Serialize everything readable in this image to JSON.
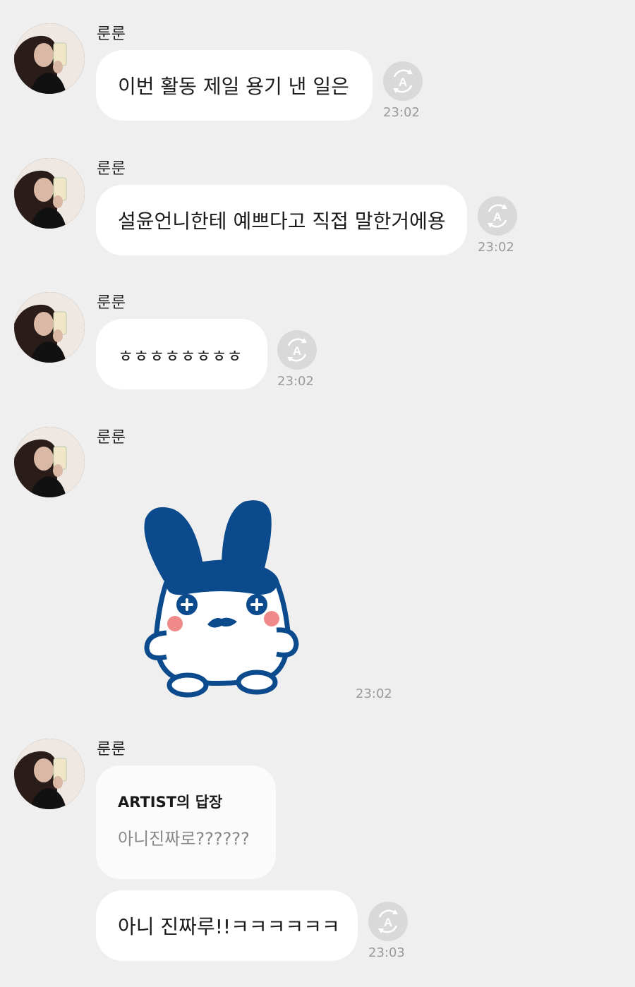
{
  "messages": [
    {
      "sender": "룬룬",
      "text": "이번 활동 제일 용기 낸 일은",
      "time": "23:02"
    },
    {
      "sender": "룬룬",
      "text": "설윤언니한테 예쁘다고 직접 말한거에용",
      "time": "23:02"
    },
    {
      "sender": "룬룬",
      "text": "ㅎㅎㅎㅎㅎㅎㅎㅎ",
      "time": "23:02"
    },
    {
      "sender": "룬룬",
      "sticker": "blue-bunny-sticker",
      "time": "23:02"
    },
    {
      "sender": "룬룬",
      "reply": {
        "title": "ARTIST의 답장",
        "quoted": "아니진짜로??????"
      },
      "text": "아니 진짜루!!ㅋㅋㅋㅋㅋㅋ",
      "time": "23:03"
    }
  ],
  "icons": {
    "translate": "translate-a-icon"
  },
  "colors": {
    "background": "#efefef",
    "bubble": "#ffffff",
    "sticker_blue": "#0b4a8c",
    "sticker_blush": "#f08a8a"
  }
}
